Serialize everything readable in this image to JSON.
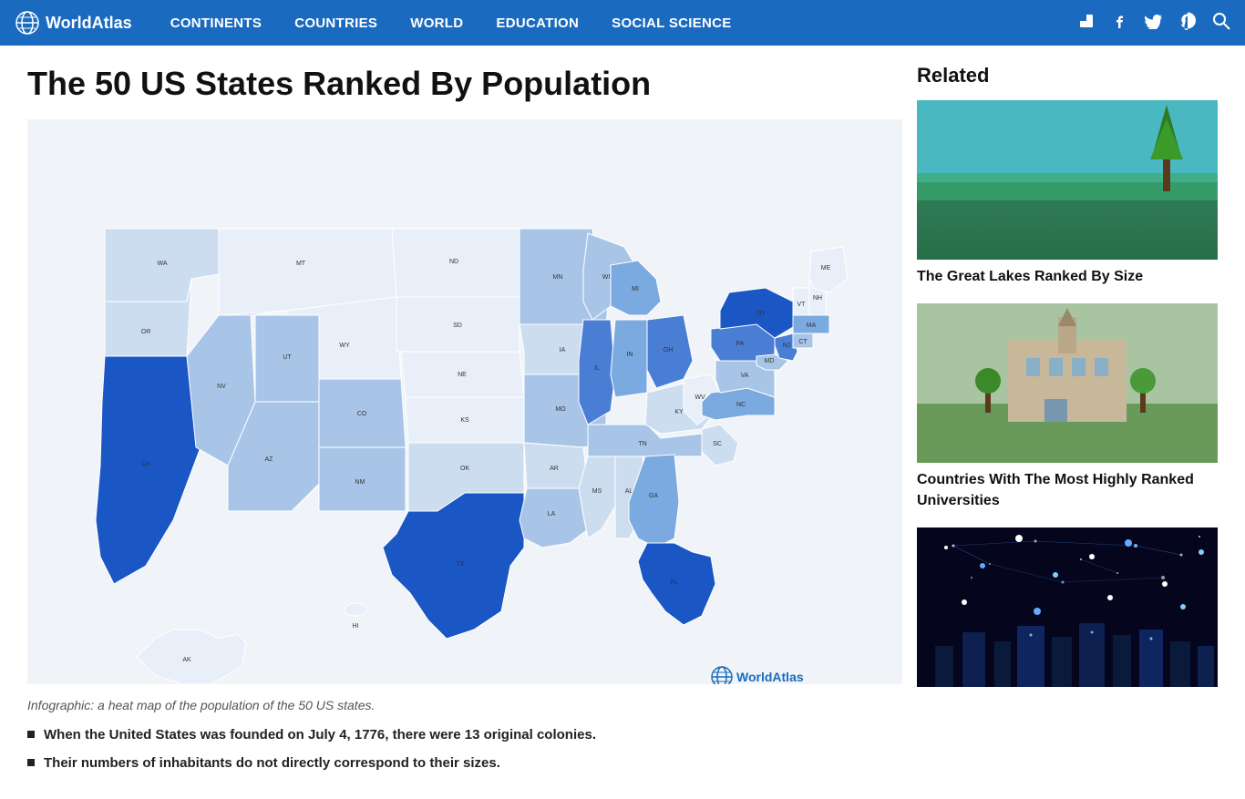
{
  "header": {
    "logo_text": "WorldAtlas",
    "nav_items": [
      "CONTINENTS",
      "COUNTRIES",
      "WORLD",
      "EDUCATION",
      "SOCIAL SCIENCE"
    ]
  },
  "main": {
    "title": "The 50 US States Ranked By Population",
    "caption": "Infographic: a heat map of the population of the 50 US states.",
    "watermark": "WorldAtlas",
    "bullets": [
      "When the United States was founded on July 4, 1776, there were 13 original colonies.",
      "Their numbers of inhabitants do not directly correspond to their sizes."
    ]
  },
  "sidebar": {
    "related_label": "Related",
    "cards": [
      {
        "title": "The Great Lakes Ranked By Size",
        "img_type": "lakes"
      },
      {
        "title": "Countries With The Most Highly Ranked Universities",
        "img_type": "univ"
      },
      {
        "title": "",
        "img_type": "tech"
      }
    ]
  }
}
